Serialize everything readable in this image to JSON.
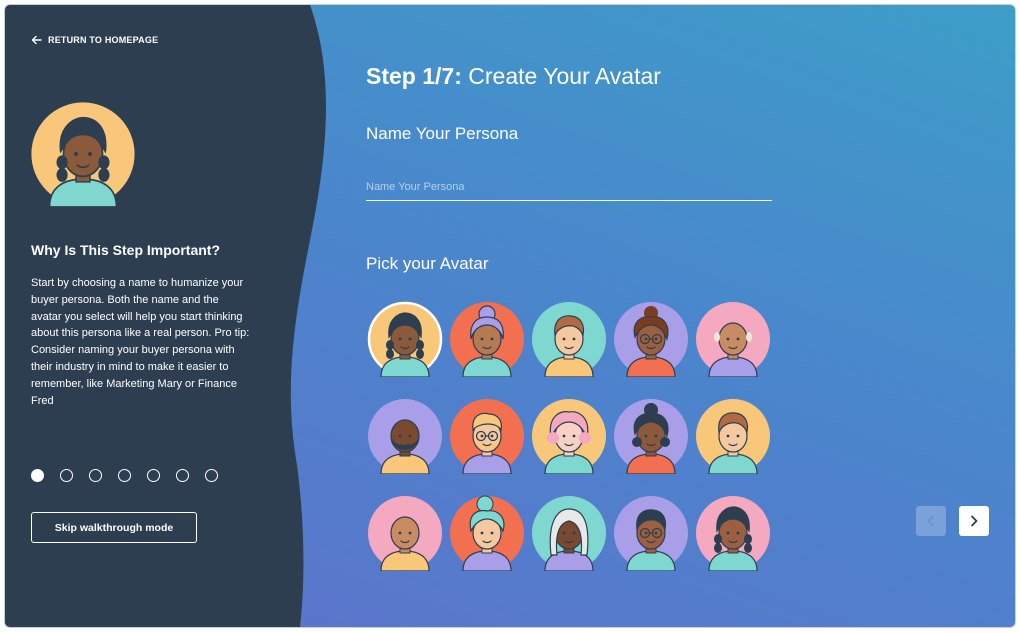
{
  "nav": {
    "return_label": "RETURN TO HOMEPAGE"
  },
  "sidebar": {
    "heading": "Why Is This Step Important?",
    "body": "Start by choosing a name to humanize your buyer persona. Both the name and the avatar you select will help you start thinking about this persona like a real person. Pro tip: Consider naming your buyer persona with their industry in mind to make it easier to remember, like Marketing Mary or Finance Fred",
    "steps_total": 7,
    "current_step": 1,
    "skip_label": "Skip walkthrough mode"
  },
  "main": {
    "step_number": "Step 1/7:",
    "step_title": " Create Your Avatar",
    "name_label": "Name Your Persona",
    "name_value": "",
    "name_placeholder": "Name Your Persona",
    "pick_label": "Pick your Avatar",
    "selected_avatar": 1
  },
  "avatars": [
    {
      "bg": "#f8c77a",
      "skin": "#8a5a3b",
      "hair": "#2d3e50",
      "shirt": "#7fd8d0",
      "style": "braids",
      "selected": true
    },
    {
      "bg": "#f26f4f",
      "skin": "#b57a52",
      "hair": "#a99ee8",
      "shirt": "#7fd8d0",
      "style": "bun-gray"
    },
    {
      "bg": "#7fd8d0",
      "skin": "#f4c9a0",
      "hair": "#b06b45",
      "shirt": "#f8c77a",
      "style": "short"
    },
    {
      "bg": "#a99ee8",
      "skin": "#9a6040",
      "hair": "#7a3e1f",
      "shirt": "#f26f4f",
      "style": "curly-glasses"
    },
    {
      "bg": "#f4a9c0",
      "skin": "#c98b62",
      "hair": "#f1e6dc",
      "shirt": "#a99ee8",
      "style": "bald-old"
    },
    {
      "bg": "#a99ee8",
      "skin": "#7a4a30",
      "hair": "#2d3e50",
      "shirt": "#f8c77a",
      "style": "beard"
    },
    {
      "bg": "#f26f4f",
      "skin": "#f4c9a0",
      "hair": "#f8c77a",
      "shirt": "#a99ee8",
      "style": "glasses-beard"
    },
    {
      "bg": "#f8c77a",
      "skin": "#f6d1c4",
      "hair": "#f4a9c0",
      "shirt": "#7fd8d0",
      "style": "pink-hair"
    },
    {
      "bg": "#a99ee8",
      "skin": "#8a5a3b",
      "hair": "#2d3e50",
      "shirt": "#f26f4f",
      "style": "curly"
    },
    {
      "bg": "#f8c77a",
      "skin": "#f4c9a0",
      "hair": "#b06b45",
      "shirt": "#7fd8d0",
      "style": "short"
    },
    {
      "bg": "#f4a9c0",
      "skin": "#c98b62",
      "hair": "#2d3e50",
      "shirt": "#f8c77a",
      "style": "bald"
    },
    {
      "bg": "#f26f4f",
      "skin": "#f4c9a0",
      "hair": "#7fd8d0",
      "shirt": "#a99ee8",
      "style": "curly-bun-teal"
    },
    {
      "bg": "#7fd8d0",
      "skin": "#7a4a30",
      "hair": "#e8e8e8",
      "shirt": "#a99ee8",
      "style": "long-gray"
    },
    {
      "bg": "#a99ee8",
      "skin": "#9a6040",
      "hair": "#2d3e50",
      "shirt": "#7fd8d0",
      "style": "glasses-short"
    },
    {
      "bg": "#f4a9c0",
      "skin": "#9a6040",
      "hair": "#2d3e50",
      "shirt": "#7fd8d0",
      "style": "braids"
    }
  ],
  "icons": {
    "back": "arrow-left-icon",
    "prev": "chevron-left-icon",
    "next": "chevron-right-icon"
  },
  "colors": {
    "sidebar": "#2d3e50",
    "accent_light": "#ffffff"
  }
}
